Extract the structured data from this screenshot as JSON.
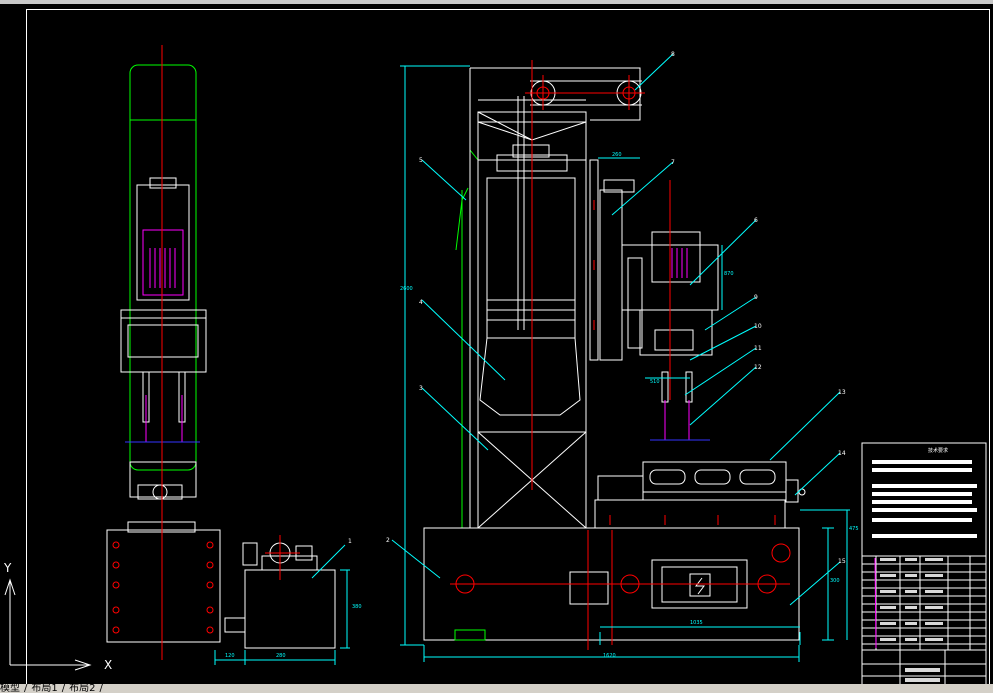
{
  "drawing": {
    "part_numbers": [
      "1",
      "2",
      "3",
      "4",
      "5",
      "6",
      "7",
      "8",
      "9",
      "10",
      "11",
      "12",
      "13",
      "14",
      "15"
    ],
    "dimensions": {
      "left_pump_offset": "120",
      "left_pump_width": "280",
      "left_pump_height": "380",
      "main_width": "1620",
      "main_inner": "1035",
      "main_height": "2600",
      "base_height": "300",
      "table_height": "475",
      "top_arm": "260",
      "head_height": "870",
      "head_offset": "510"
    },
    "title_block": {
      "title": "技术要求"
    },
    "axis": {
      "x": "X",
      "y": "Y"
    }
  },
  "tabs": {
    "items": [
      "模型",
      "布局1",
      "布局2"
    ]
  },
  "colors": {
    "background": "#000000",
    "outline": "#ffffff",
    "centerline": "#ff0000",
    "dimension": "#00ffff",
    "green": "#00ff00",
    "yellow": "#ffff00",
    "magenta": "#ff00ff",
    "blue": "#3333ff"
  }
}
